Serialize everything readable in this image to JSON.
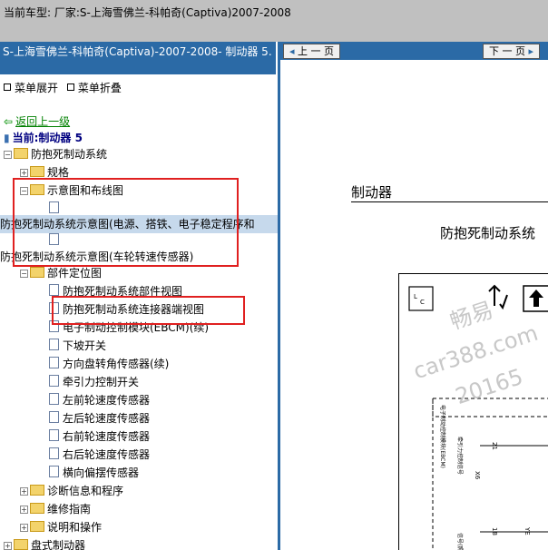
{
  "topbar": {
    "title": "当前车型:   厂家:S-上海雪佛兰-科帕奇(Captiva)2007-2008"
  },
  "left": {
    "header": "S-上海雪佛兰-科帕奇(Captiva)-2007-2008- 制动器 5.",
    "menu_expand": "菜单展开",
    "menu_collapse": "菜单折叠",
    "back": "返回上一级",
    "current": "当前:制动器 5",
    "tree": [
      {
        "label": "防抱死制动系统",
        "type": "folder"
      },
      {
        "label": "规格",
        "type": "folder"
      },
      {
        "label": "示意图和布线图",
        "type": "folder"
      },
      {
        "label": "",
        "type": "doc"
      },
      {
        "label": "防抱死制动系统示意图(电源、搭铁、电子稳定程序和",
        "type": "text"
      },
      {
        "label": "",
        "type": "doc"
      },
      {
        "label": "防抱死制动系统示意图(车轮转速传感器)",
        "type": "text"
      },
      {
        "label": "部件定位图",
        "type": "folder"
      },
      {
        "label": "防抱死制动系统部件视图",
        "type": "doc"
      },
      {
        "label": "防抱死制动系统连接器端视图",
        "type": "doc"
      },
      {
        "label": "电子制动控制模块(EBCM)(续)",
        "type": "doc"
      },
      {
        "label": "下坡开关",
        "type": "doc"
      },
      {
        "label": "方向盘转角传感器(续)",
        "type": "doc"
      },
      {
        "label": "牵引力控制开关",
        "type": "doc"
      },
      {
        "label": "左前轮速度传感器",
        "type": "doc"
      },
      {
        "label": "左后轮速度传感器",
        "type": "doc"
      },
      {
        "label": "右前轮速度传感器",
        "type": "doc"
      },
      {
        "label": "右后轮速度传感器",
        "type": "doc"
      },
      {
        "label": "横向偏摆传感器",
        "type": "doc"
      },
      {
        "label": "诊断信息和程序",
        "type": "folder"
      },
      {
        "label": "维修指南",
        "type": "folder"
      },
      {
        "label": "说明和操作",
        "type": "folder"
      },
      {
        "label": "盘式制动器",
        "type": "folder"
      }
    ]
  },
  "right": {
    "prev": "上 一 页",
    "next": "下 一 页",
    "section_title": "制动器",
    "diagram_title": "防抱死制动系统",
    "diag_label_ebcm": "电子制动控制模块(EBCM)",
    "diag_label_tcs": "牵引力控制信号",
    "diag_pin_21": "21",
    "diag_pin_18": "18",
    "diag_conn": "X6",
    "diag_wire": "YE",
    "diag_label_signal": "信号(照明 +)",
    "watermark1": "畅易",
    "watermark2": "car388.com",
    "watermark3": "20165"
  }
}
